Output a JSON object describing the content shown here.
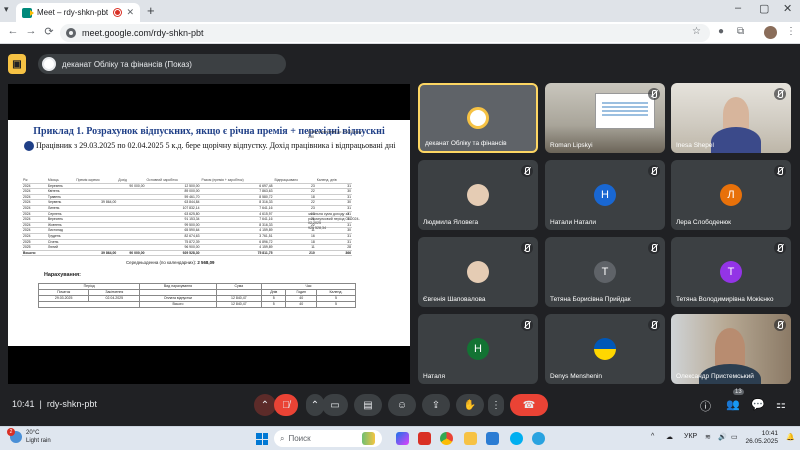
{
  "browser": {
    "tab_title": "Meet – rdy-shkn-pbt",
    "url": "meet.google.com/rdy-shkn-pbt",
    "new_tab": "+",
    "nav": {
      "back": "←",
      "forward": "→",
      "reload": "C"
    },
    "window_controls": {
      "minimize": "–",
      "maximize": "▢",
      "close": "✕"
    }
  },
  "meet": {
    "presenter_label": "деканат Обліку та фінансів (Показ)",
    "present_icon": "present-icon",
    "meeting_code": "rdy-shkn-pbt",
    "time": "10:41",
    "participants_count": "13"
  },
  "document": {
    "title": "Приклад 1. Розрахунок відпускних, якщо є річна премія + перехідні відпускні",
    "paragraph": "Працівник з 29.03.2025 по 02.04.2025 5 к.д. бере щорічну відпустку. Дохід працівника і відпрацьовані дні",
    "sheet_headers": [
      "Рік",
      "Місяць",
      "Премія окремо",
      "Дохід",
      "Основний заробіток",
      "Разом (премія + заробіток)",
      "Відпрацьовано",
      "Календ. днів"
    ],
    "sheet_rows": [
      [
        "2024",
        "Березень",
        "",
        "90 000,00",
        "12 500,00",
        "6 697,48",
        "23",
        "31"
      ],
      [
        "2024",
        "Квітень",
        "",
        "",
        "89 000,00",
        "7 863,63",
        "22",
        "30"
      ],
      [
        "2024",
        "Травень",
        "",
        "",
        "59 461,70",
        "8 580,72",
        "18",
        "31"
      ],
      [
        "2024",
        "Червень",
        "39 864,00",
        "",
        "63 844,84",
        "8 316,33",
        "22",
        "30"
      ],
      [
        "2024",
        "Липень",
        "",
        "",
        "107 832,14",
        "7 641,16",
        "23",
        "31"
      ],
      [
        "2024",
        "Серпень",
        "",
        "",
        "63 625,80",
        "4 615,97",
        "13",
        "31"
      ],
      [
        "2024",
        "Вересень",
        "",
        "",
        "91 153,34",
        "7 641,16",
        "21",
        "30"
      ],
      [
        "2024",
        "Жовтень",
        "",
        "",
        "99 500,00",
        "8 316,33",
        "22",
        "31"
      ],
      [
        "2024",
        "Листопад",
        "",
        "",
        "65 590,64",
        "4 159,89",
        "11",
        "30"
      ],
      [
        "2024",
        "Грудень",
        "",
        "",
        "82 674,63",
        "3 761,51",
        "16",
        "31"
      ],
      [
        "2025",
        "Січень",
        "",
        "",
        "75 872,39",
        "6 896,72",
        "18",
        "31"
      ],
      [
        "2025",
        "Лютий",
        "",
        "",
        "96 900,00",
        "4 159,89",
        "11",
        "28"
      ]
    ],
    "sheet_total": [
      "Всього:",
      "",
      "39 864,00",
      "90 000,00",
      "929 528,30",
      "75 811,75",
      "210",
      "366"
    ],
    "side_note_top": "Дохід включений до 2 2021 року",
    "side_note_top_value": "230",
    "side_note_bottom": "загальна сума доходу за розрахунковий період 01.2024-02.2025",
    "side_note_bottom_value": "929 528,34",
    "avg_label": "Середньоденна (по календарних):",
    "avg_value": "2 568,09",
    "accrual_title": "Нарахування:",
    "acc_headers": [
      "Період",
      "Вид нарахування",
      "Сума",
      "Час"
    ],
    "acc_subheaders": [
      "Початок",
      "Закінчення",
      "",
      "",
      "Днів",
      "Годин",
      "Календ."
    ],
    "acc_row": [
      "29.03.2025",
      "02.04.2025",
      "Оплата відпустки",
      "12 840,47",
      "5",
      "40",
      "5"
    ],
    "acc_total": [
      "Всього",
      "12 840,47",
      "5",
      "40",
      "5"
    ]
  },
  "tiles": [
    {
      "name": "деканат Обліку та фінансів",
      "kind": "emblem",
      "active": true,
      "mic_off": false
    },
    {
      "name": "Roman Lipskyi",
      "kind": "room",
      "mic_off": true
    },
    {
      "name": "Inesa Shepel",
      "kind": "office",
      "mic_off": true
    },
    {
      "name": "Людмила Яловега",
      "kind": "photo",
      "mic_off": true
    },
    {
      "name": "Натали Натали",
      "kind": "letter",
      "letter": "Н",
      "color": "#1967d2",
      "mic_off": true
    },
    {
      "name": "Лера Слободенюк",
      "kind": "letter",
      "letter": "Л",
      "color": "#e8710a",
      "mic_off": true
    },
    {
      "name": "Євгенія Шаповалова",
      "kind": "photo",
      "mic_off": true
    },
    {
      "name": "Тетяна Борисівна Прийдак",
      "kind": "letter",
      "letter": "Т",
      "color": "#5f6368",
      "mic_off": true
    },
    {
      "name": "Тетяна Володимирівна Мокієнко",
      "kind": "letter",
      "letter": "Т",
      "color": "#9334e6",
      "mic_off": true
    },
    {
      "name": "Наталя",
      "kind": "letter",
      "letter": "Н",
      "color": "#137333",
      "mic_off": true
    },
    {
      "name": "Denys Menshenin",
      "kind": "flag",
      "mic_off": true
    },
    {
      "name": "Олександр Пристемський",
      "kind": "books",
      "mic_off": true
    }
  ],
  "taskbar": {
    "weather_temp": "20°C",
    "weather_text": "Light rain",
    "weather_badge": "2",
    "search_placeholder": "Поиск",
    "lang": "УКР",
    "clock_time": "10:41",
    "clock_date": "26.05.2025"
  },
  "colors": {
    "meet_bg": "#202124",
    "tile_bg": "#3c4043",
    "active_border": "#fdd663",
    "leave_red": "#ea4335",
    "doc_title_blue": "#1f3f87"
  }
}
